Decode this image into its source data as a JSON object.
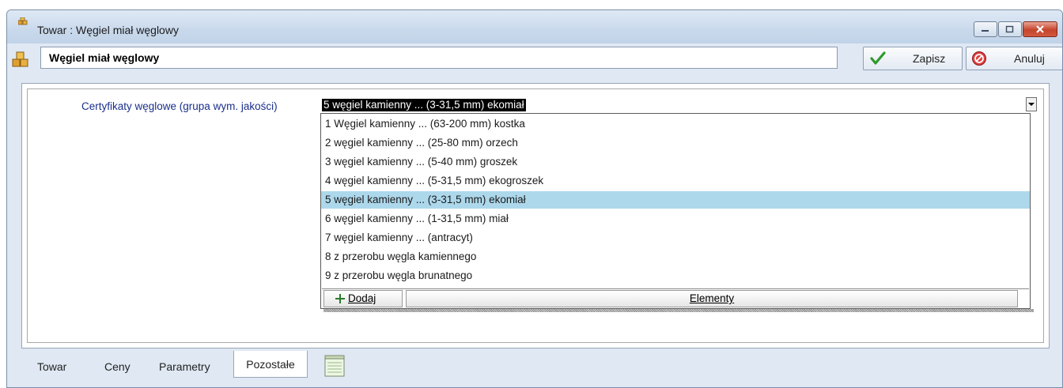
{
  "window": {
    "title": "Towar : Węgiel miał węglowy"
  },
  "toolbar": {
    "name_value": "Węgiel miał węglowy",
    "save_label": "Zapisz",
    "cancel_label": "Anuluj"
  },
  "form": {
    "field_label": "Certyfikaty węglowe (grupa wym. jakości)",
    "combo_value": "5 węgiel kamienny ... (3-31,5 mm) ekomiał"
  },
  "dropdown": {
    "items": [
      "1 Węgiel kamienny ... (63-200 mm) kostka",
      "2 węgiel kamienny ... (25-80 mm) orzech",
      "3 węgiel kamienny ... (5-40 mm) groszek",
      "4 węgiel kamienny ... (5-31,5 mm) ekogroszek",
      "5 węgiel kamienny ... (3-31,5 mm) ekomiał",
      "6 węgiel kamienny ... (1-31,5 mm) miał",
      "7 węgiel kamienny ... (antracyt)",
      "8 z przerobu węgla kamiennego",
      "9 z przerobu węgla brunatnego"
    ],
    "selected_index": 4,
    "add_label": "Dodaj",
    "elements_label": "Elementy"
  },
  "tabs": [
    {
      "label": "Towar"
    },
    {
      "label": "Ceny"
    },
    {
      "label": "Parametry"
    },
    {
      "label": "Pozostałe"
    }
  ],
  "colors": {
    "selected_row": "#add8ec",
    "label_blue": "#1a2f8c"
  }
}
